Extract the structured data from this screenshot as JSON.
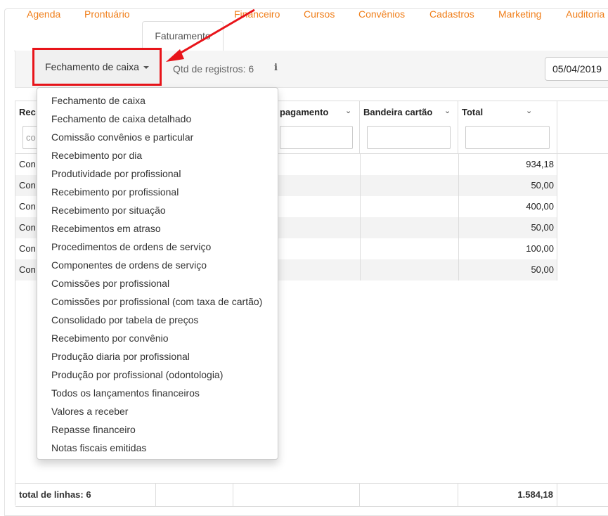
{
  "tabs": [
    {
      "label": "Agenda",
      "active": false
    },
    {
      "label": "Prontuário",
      "active": false
    },
    {
      "label": "Faturamento",
      "active": true
    },
    {
      "label": "Financeiro",
      "active": false
    },
    {
      "label": "Cursos",
      "active": false
    },
    {
      "label": "Convênios",
      "active": false
    },
    {
      "label": "Cadastros",
      "active": false
    },
    {
      "label": "Marketing",
      "active": false
    },
    {
      "label": "Auditoria",
      "active": false
    }
  ],
  "toolbar": {
    "report_button_label": "Fechamento de caixa",
    "record_count": "Qtd de registros: 6",
    "info_icon": "i",
    "date_value": "05/04/2019"
  },
  "grid": {
    "columns": [
      {
        "title": "Rec",
        "filter_placeholder": "co"
      },
      {
        "title": "pagamento",
        "filter_placeholder": ""
      },
      {
        "title": "Bandeira cartão",
        "filter_placeholder": ""
      },
      {
        "title": "Total",
        "filter_placeholder": ""
      }
    ],
    "rows": [
      {
        "rec": "Con",
        "total": "934,18"
      },
      {
        "rec": "Con",
        "total": "50,00"
      },
      {
        "rec": "Con",
        "total": "400,00"
      },
      {
        "rec": "Con",
        "total": "50,00"
      },
      {
        "rec": "Con",
        "total": "100,00"
      },
      {
        "rec": "Con",
        "total": "50,00"
      }
    ],
    "footer": {
      "label": "total de linhas: 6",
      "total": "1.584,18"
    }
  },
  "dropdown": {
    "items": [
      "Fechamento de caixa",
      "Fechamento de caixa detalhado",
      "Comissão convênios e particular",
      "Recebimento por dia",
      "Produtividade por profissional",
      "Recebimento por profissional",
      "Recebimento por situação",
      "Recebimentos em atraso",
      "Procedimentos de ordens de serviço",
      "Componentes de ordens de serviço",
      "Comissões por profissional",
      "Comissões por profissional (com taxa de cartão)",
      "Consolidado por tabela de preços",
      "Recebimento por convênio",
      "Produção diaria por profissional",
      "Produção por profissional (odontologia)",
      "Todos os lançamentos financeiros",
      "Valores a receber",
      "Repasse financeiro",
      "Notas fiscais emitidas"
    ]
  },
  "colors": {
    "accent": "#f07f1b",
    "highlight": "#e8141a",
    "stripe": "#f3f3f3"
  }
}
